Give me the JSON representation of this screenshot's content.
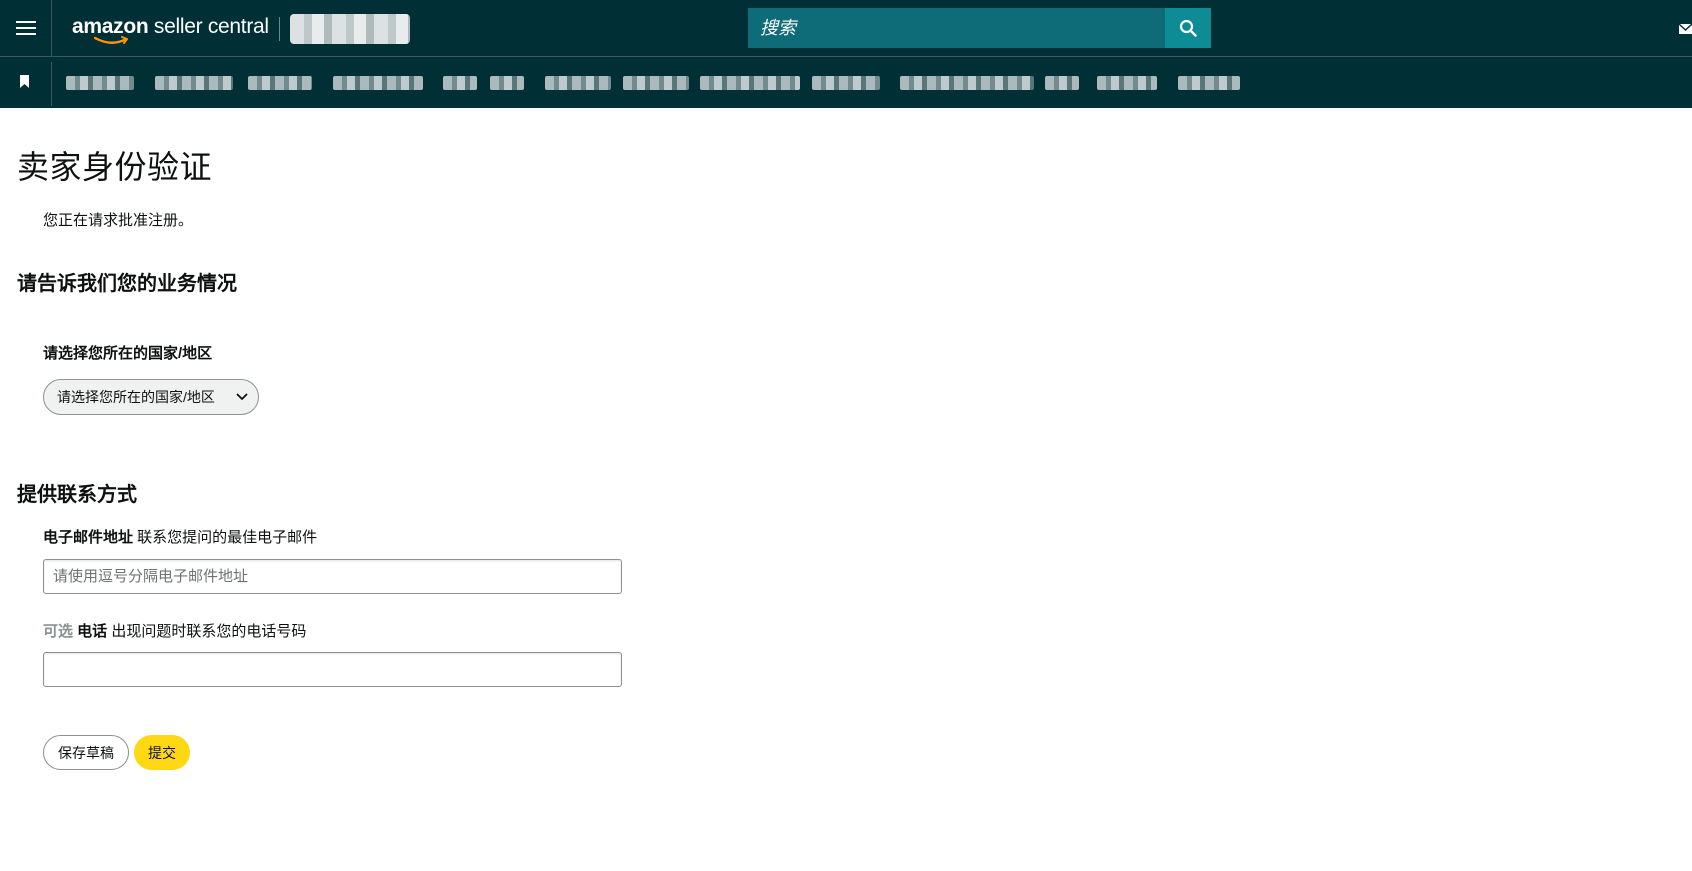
{
  "header": {
    "logo_text_bold": "amazon",
    "logo_text_rest": " seller central",
    "search_placeholder": "搜索",
    "icons": [
      "menu-icon",
      "search-icon",
      "mail-icon"
    ]
  },
  "navbar": {
    "icons": [
      "bookmark-icon"
    ]
  },
  "page": {
    "title": "卖家身份验证",
    "subtext": "您正在请求批准注册。"
  },
  "business": {
    "heading": "请告诉我们您的业务情况",
    "country_label": "请选择您所在的国家/地区",
    "country_select_value": "请选择您所在的国家/地区"
  },
  "contact": {
    "heading": "提供联系方式",
    "email_label": "电子邮件地址",
    "email_hint": " 联系您提问的最佳电子邮件",
    "email_placeholder": "请使用逗号分隔电子邮件地址",
    "email_value": "",
    "phone_optional": "可选",
    "phone_label": " 电话",
    "phone_hint": " 出现问题时联系您的电话号码",
    "phone_value": ""
  },
  "actions": {
    "save_draft": "保存草稿",
    "submit": "提交"
  },
  "colors": {
    "header_bg": "#002f36",
    "search_bg": "#0e6c78",
    "search_button_bg": "#0d8c96",
    "submit_bg": "#ffd814"
  }
}
